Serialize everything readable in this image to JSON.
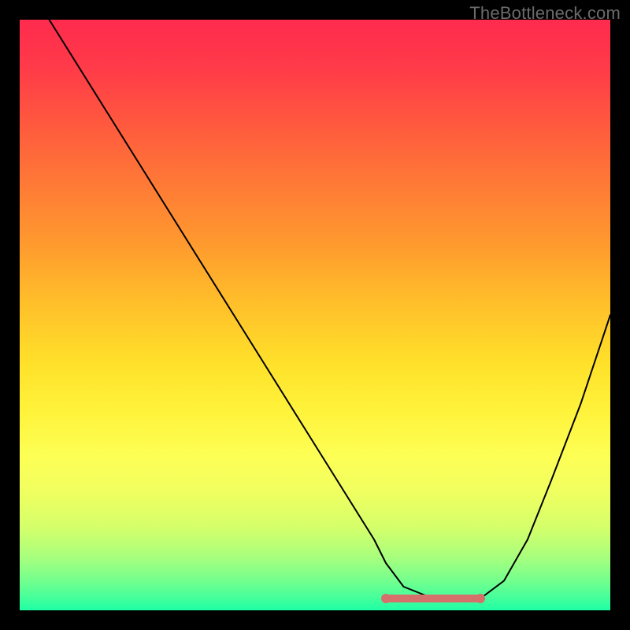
{
  "watermark": "TheBottleneck.com",
  "colors": {
    "background": "#000000",
    "curve": "#000000",
    "flat_accent": "#d5706b",
    "gradient_top": "#ff2b4e",
    "gradient_bottom": "#1fffa5"
  },
  "chart_data": {
    "type": "line",
    "title": "",
    "xlabel": "",
    "ylabel": "",
    "xlim": [
      0,
      100
    ],
    "ylim": [
      0,
      100
    ],
    "series": [
      {
        "name": "bottleneck-curve",
        "x": [
          5,
          10,
          15,
          20,
          25,
          30,
          35,
          40,
          45,
          50,
          55,
          60,
          62,
          65,
          70,
          75,
          78,
          82,
          86,
          90,
          95,
          100
        ],
        "values": [
          100,
          92,
          84,
          76,
          68,
          60,
          52,
          44,
          36,
          28,
          20,
          12,
          8,
          4,
          2,
          2,
          2,
          5,
          12,
          22,
          35,
          50
        ]
      }
    ],
    "flat_region": {
      "x_start": 62,
      "x_end": 78,
      "y": 2
    }
  }
}
